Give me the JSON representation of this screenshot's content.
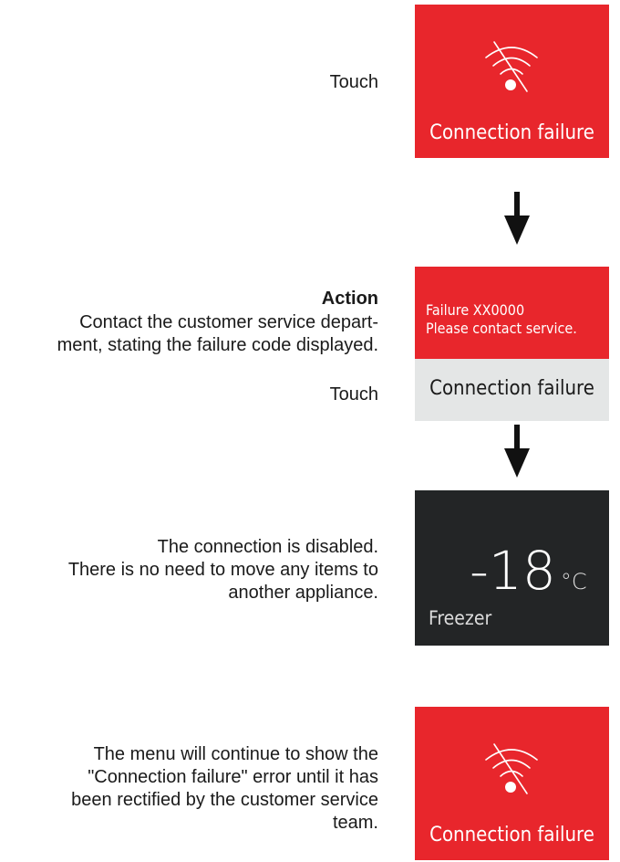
{
  "steps": {
    "touch_1": "Touch",
    "action_heading": "Action",
    "action_line1": "Contact the customer service depart-",
    "action_line2": "ment, stating the failure code displayed.",
    "touch_2": "Touch",
    "disabled_line1": "The connection is disabled.",
    "disabled_line2": "There is no need to move any items to",
    "disabled_line3": "another appliance.",
    "menu_line1": "The menu will continue to show the",
    "menu_line2": "\"Connection failure\" error until it has",
    "menu_line3": "been rectified by the customer service",
    "menu_line4": "team."
  },
  "screens": {
    "connection_failure_label": "Connection failure",
    "failure_code_line": "Failure XX0000",
    "failure_contact_line": "Please contact service.",
    "failure_footer": "Connection failure",
    "temperature_value": "-18",
    "temperature_unit": "°C",
    "zone_label": "Freezer",
    "connection_failure_label_2": "Connection failure"
  },
  "icons": {
    "wifi": "wifi-off-icon",
    "arrow": "arrow-down-icon"
  },
  "colors": {
    "alert_red": "#e8262c",
    "display_dark": "#232526",
    "footer_grey": "#e4e6e6"
  }
}
